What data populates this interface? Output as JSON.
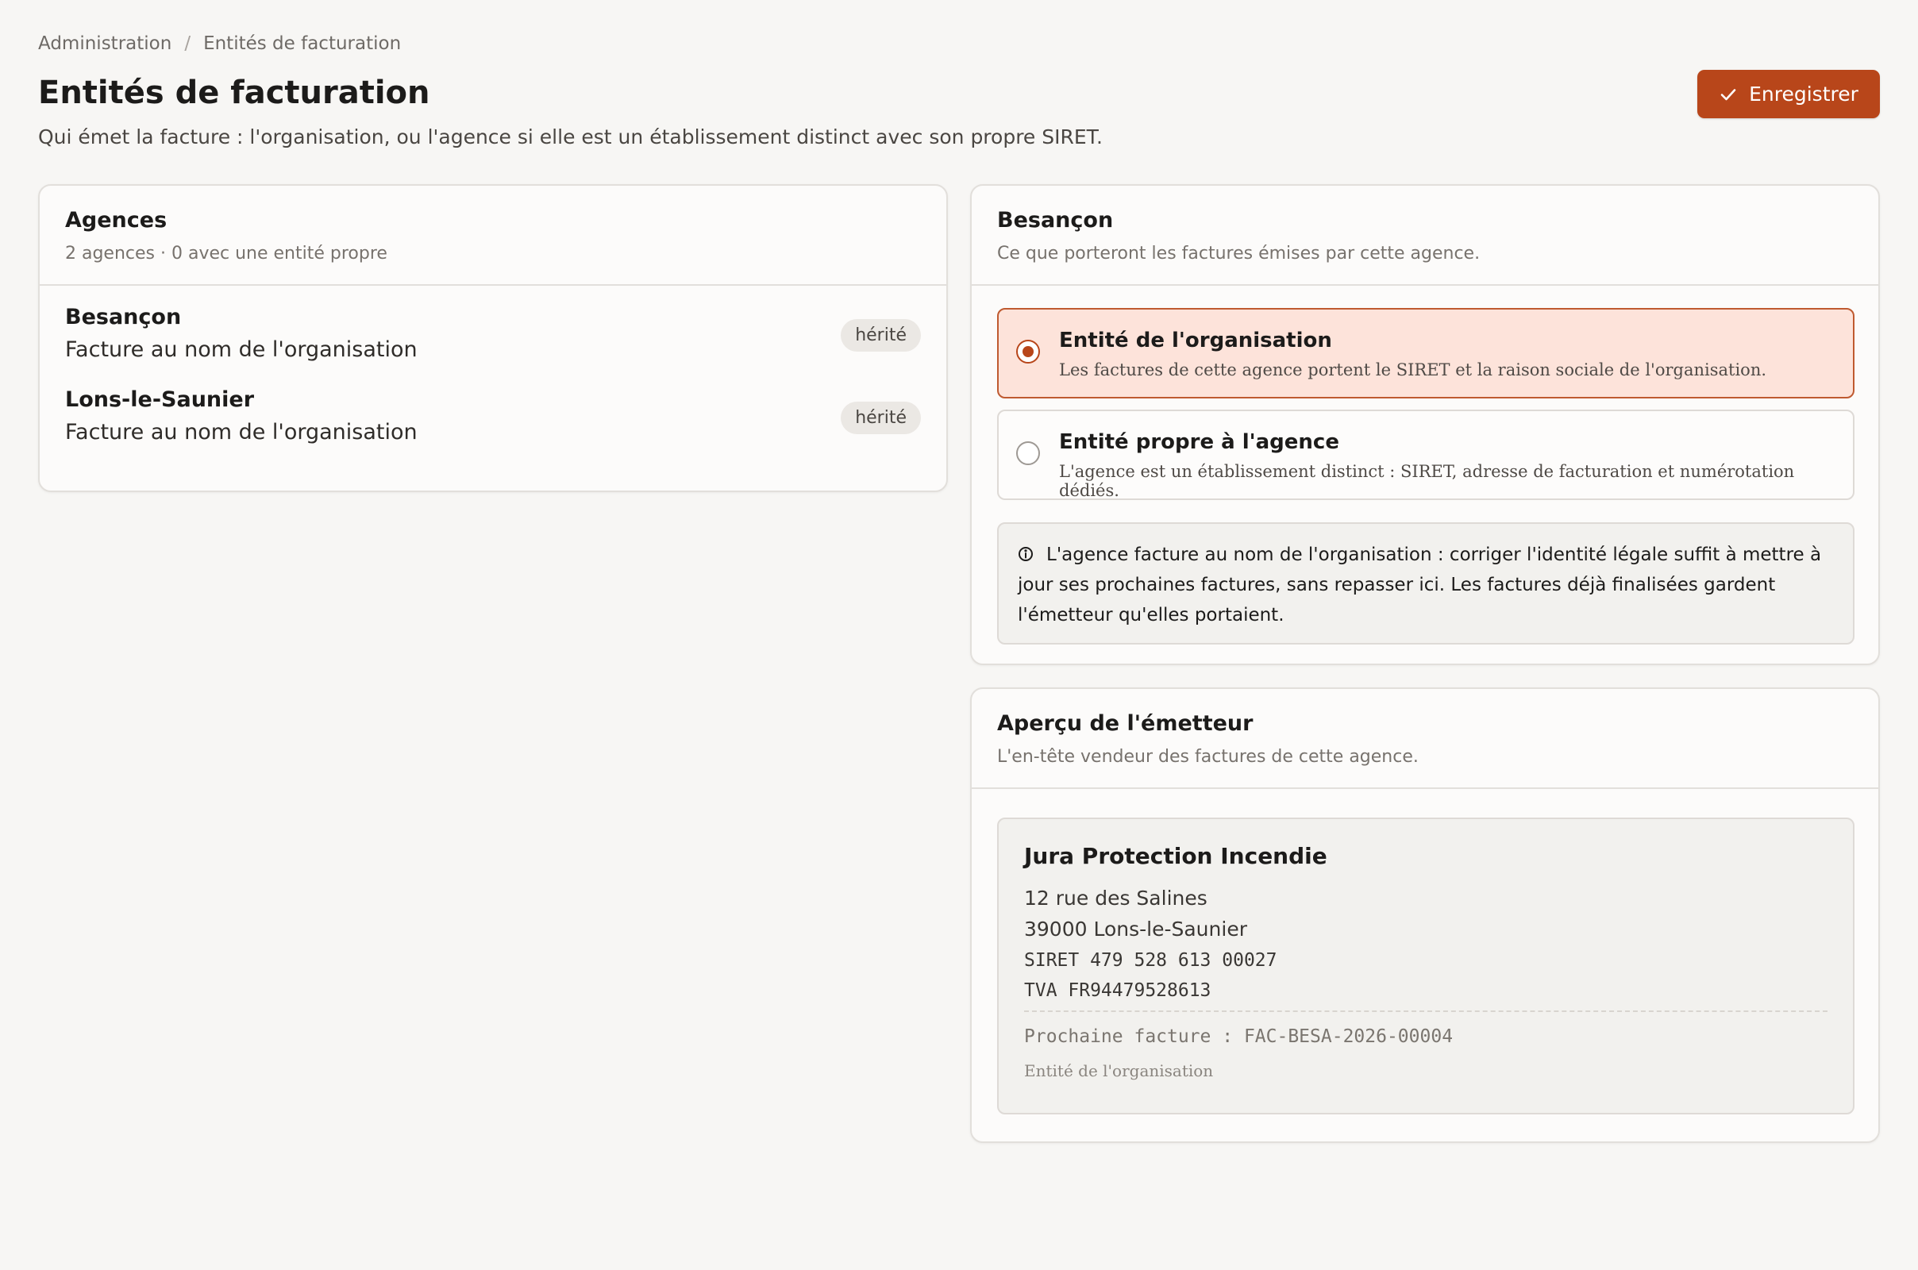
{
  "breadcrumb": {
    "items": [
      "Administration",
      "Entités de facturation"
    ],
    "separator": "/"
  },
  "page": {
    "title": "Entités de facturation",
    "subtitle": "Qui émet la facture : l'organisation, ou l'agence si elle est un établissement distinct avec son propre SIRET."
  },
  "toolbar": {
    "save_label": "Enregistrer",
    "save_icon": "check-icon"
  },
  "agencies": {
    "title": "Agences",
    "summary": "2 agences · 0 avec une entité propre",
    "items": [
      {
        "name": "Besançon",
        "subtitle": "Facture au nom de l'organisation",
        "badge": "hérité"
      },
      {
        "name": "Lons-le-Saunier",
        "subtitle": "Facture au nom de l'organisation",
        "badge": "hérité"
      }
    ]
  },
  "detail": {
    "title": "Besançon",
    "description": "Ce que porteront les factures émises par cette agence.",
    "options": [
      {
        "title": "Entité de l'organisation",
        "description": "Les factures de cette agence portent le SIRET et la raison sociale de l'organisation.",
        "selected": true
      },
      {
        "title": "Entité propre à l'agence",
        "description": "L'agence est un établissement distinct : SIRET, adresse de facturation et numérotation dédiés.",
        "selected": false
      }
    ],
    "info": "L'agence facture au nom de l'organisation : corriger l'identité légale suffit à mettre à jour ses prochaines factures, sans repasser ici. Les factures déjà finalisées gardent l'émetteur qu'elles portaient.",
    "info_icon": "info-icon"
  },
  "preview": {
    "title": "Aperçu de l'émetteur",
    "description": "L'en-tête vendeur des factures de cette agence.",
    "issuer_name": "Jura Protection Incendie",
    "address_line1": "12 rue des Salines",
    "address_line2": "39000 Lons-le-Saunier",
    "siret": "SIRET 479 528 613 00027",
    "tva": "TVA FR94479528613",
    "next_invoice": "Prochaine facture : FAC-BESA-2026-00004",
    "entity_note": "Entité de l'organisation"
  },
  "colors": {
    "accent": "#b8461a",
    "selected_bg": "#fde3da",
    "background": "#f7f6f4"
  }
}
